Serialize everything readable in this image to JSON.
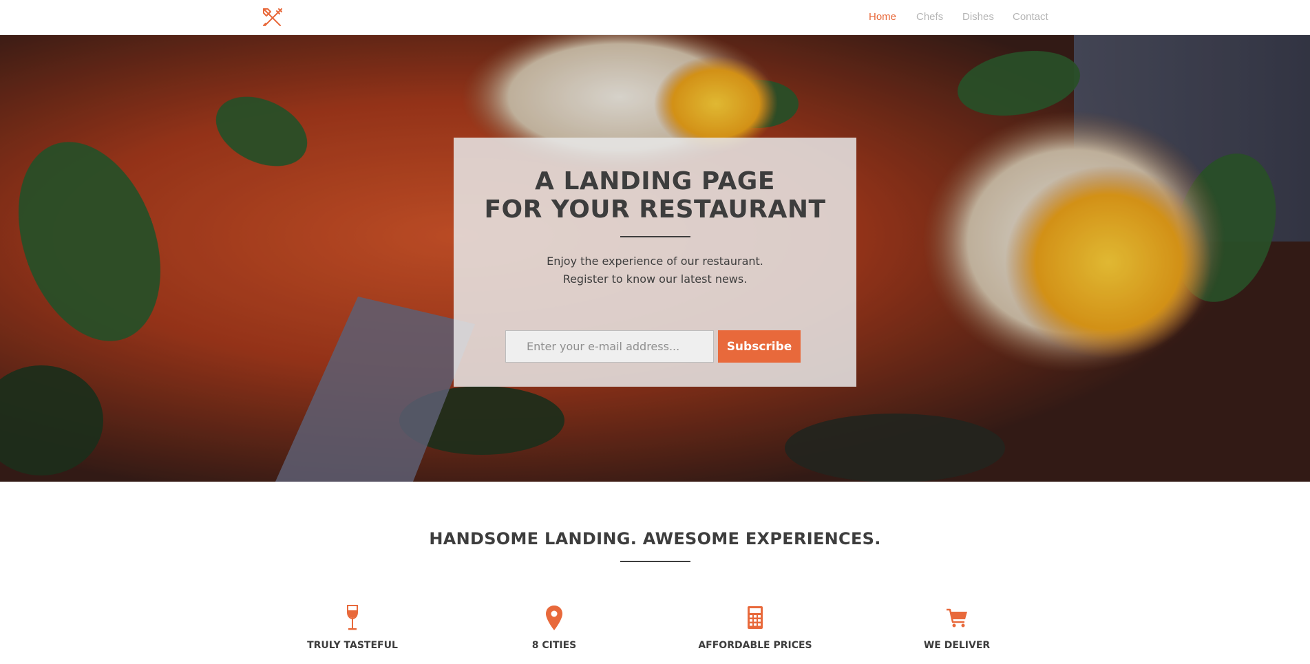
{
  "navbar": {
    "logo_icon": "crossed-utensils-icon",
    "links": [
      {
        "label": "Home",
        "active": true
      },
      {
        "label": "Chefs",
        "active": false
      },
      {
        "label": "Dishes",
        "active": false
      },
      {
        "label": "Contact",
        "active": false
      }
    ]
  },
  "hero": {
    "title_line1": "A LANDING PAGE",
    "title_line2": "FOR YOUR RESTAURANT",
    "subtitle_line1": "Enjoy the experience of our restaurant.",
    "subtitle_line2": "Register to know our latest news.",
    "email_placeholder": "Enter your e-mail address...",
    "subscribe_label": "Subscribe"
  },
  "features_section": {
    "title": "HANDSOME LANDING. AWESOME EXPERIENCES.",
    "items": [
      {
        "icon": "wine-glass-icon",
        "label": "TRULY TASTEFUL"
      },
      {
        "icon": "map-pin-icon",
        "label": "8 CITIES"
      },
      {
        "icon": "calculator-icon",
        "label": "AFFORDABLE PRICES"
      },
      {
        "icon": "shopping-cart-icon",
        "label": "WE DELIVER"
      }
    ]
  },
  "colors": {
    "accent": "#e8693b",
    "text_dark": "#3d3d3d",
    "nav_inactive": "#b5b5b5"
  }
}
